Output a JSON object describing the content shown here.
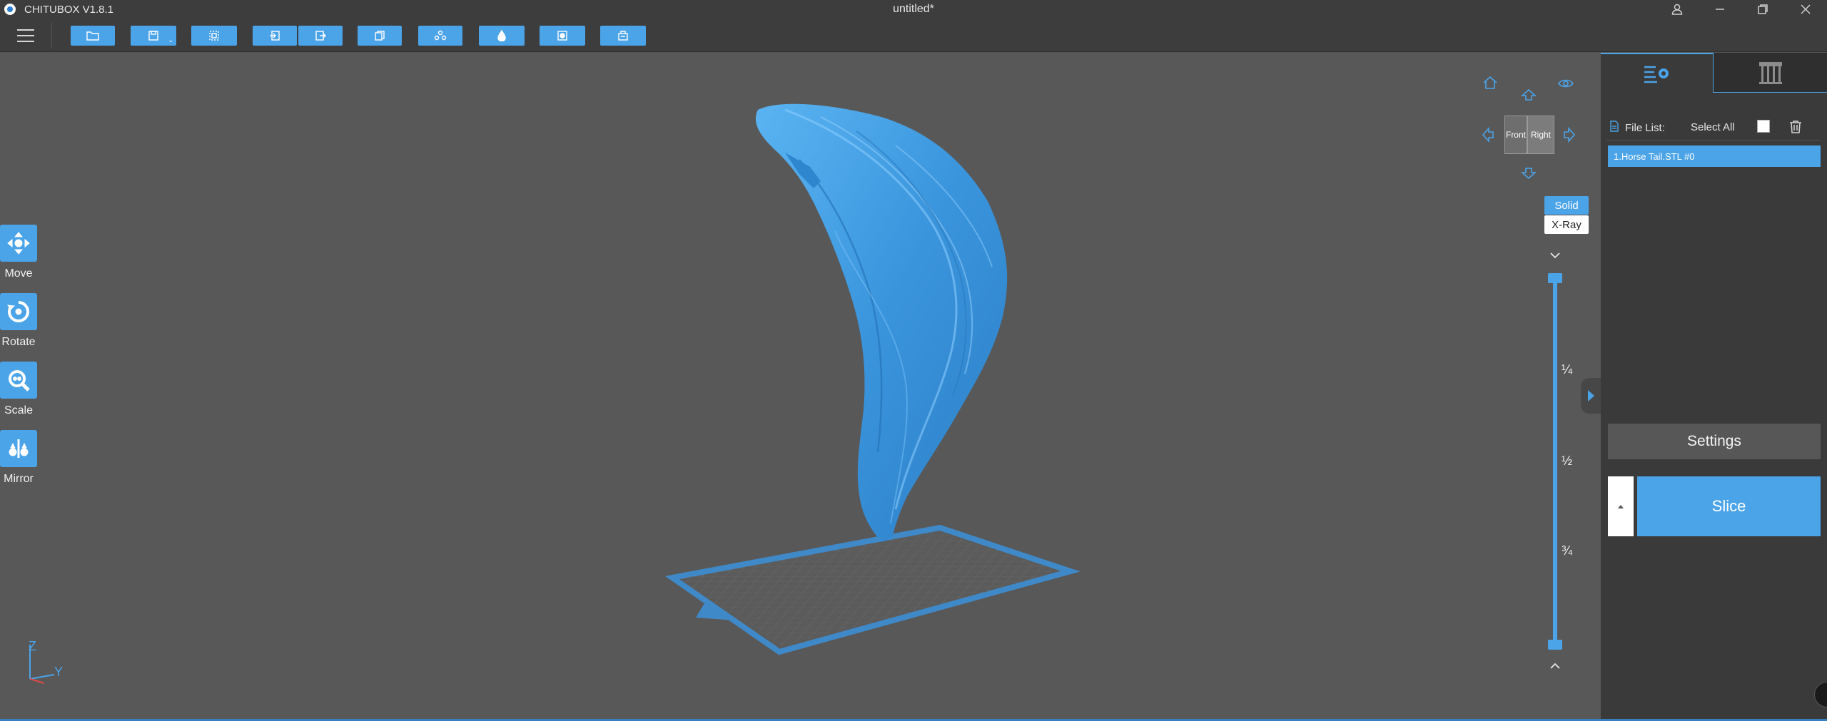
{
  "titlebar": {
    "app_name": "CHITUBOX V1.8.1",
    "document_title": "untitled*"
  },
  "toolbar": {
    "buttons": [
      {
        "icon": "folder-open-icon"
      },
      {
        "icon": "save-icon"
      },
      {
        "icon": "select-all-icon"
      },
      {
        "icon": "import-icon"
      },
      {
        "icon": "export-icon"
      },
      {
        "icon": "copy-icon"
      },
      {
        "icon": "arrange-icon"
      },
      {
        "icon": "hollow-icon"
      },
      {
        "icon": "drill-hole-icon"
      },
      {
        "icon": "clip-model-icon"
      }
    ]
  },
  "left_tools": [
    {
      "label": "Move",
      "icon": "move-icon"
    },
    {
      "label": "Rotate",
      "icon": "rotate-icon"
    },
    {
      "label": "Scale",
      "icon": "scale-icon"
    },
    {
      "label": "Mirror",
      "icon": "mirror-icon"
    }
  ],
  "view_cube": {
    "front_label": "Front",
    "right_label": "Right"
  },
  "render_modes": {
    "solid": "Solid",
    "xray": "X-Ray"
  },
  "slider": {
    "ticks": [
      "¼",
      "½",
      "¾"
    ]
  },
  "axes": {
    "z": "Z",
    "y": "Y"
  },
  "right_panel": {
    "file_list_label": "File List:",
    "select_all_label": "Select All",
    "files": [
      "1.Horse Tail.STL #0"
    ],
    "settings_label": "Settings",
    "slice_label": "Slice"
  },
  "colors": {
    "accent": "#4BA3E8",
    "background": "#585858",
    "panel": "#3A3A3A"
  }
}
